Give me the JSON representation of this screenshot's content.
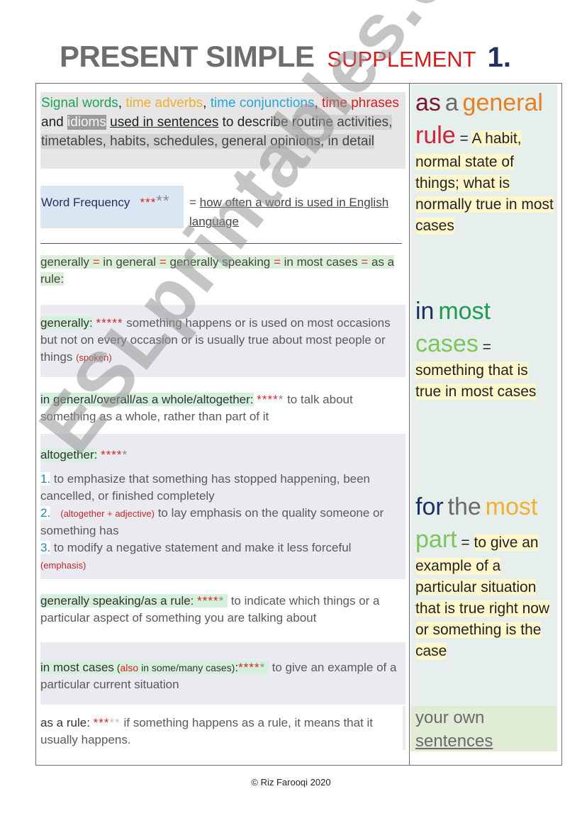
{
  "title": {
    "main": "PRESENT SIMPLE",
    "supplement": "SUPPLEMENT",
    "number": "1."
  },
  "intro": {
    "signal_words": "Signal words",
    "sep1": ", ",
    "time_adverbs": "time adverbs",
    "sep2": ", ",
    "time_conjunctions": "time conjunctions",
    "sep3": ", ",
    "time_phrases": "time phrases",
    "and": " and ",
    "idioms": "idioms",
    "space": " ",
    "used_in_sentences": "used in sentences",
    "to_describe": " to describe ",
    "routine": "routine activities",
    "rest": ", timetables, habits, schedules, general opinions,  in detail"
  },
  "frequency": {
    "label": "Word Frequency",
    "stars_red": "***",
    "stars_grey": "**",
    "eq": "=",
    "definition": "how often a word is used in English language"
  },
  "synonyms": {
    "items": [
      "generally",
      "in general",
      "generally speaking",
      "in most cases",
      "as a rule:"
    ],
    "eq": "="
  },
  "entries": [
    {
      "term": "generally:",
      "stars_red": "*****",
      "stars_grey": "",
      "definition": " something happens or is used on most occasions but not on every occasion or is usually true about most people or things ",
      "note": "(spoken)"
    },
    {
      "term": "in general/overall/as a whole/altogether:",
      "stars_red": "****",
      "stars_grey": "*",
      "definition": "  to talk about something as a whole, rather than part of it"
    },
    {
      "term": "altogether:",
      "stars_red": "****",
      "stars_grey": "*",
      "senses": [
        {
          "num": "1.",
          "text": " to emphasize that something has stopped happening, been cancelled, or finished completely"
        },
        {
          "num": "2.",
          "note": "(altogether + adjective)",
          "text": " to lay emphasis on the quality someone or something has"
        },
        {
          "num": "3.",
          "text": "  to modify a negative statement and make it less forceful",
          "note": "(emphasis)"
        }
      ]
    },
    {
      "term": "generally speaking/as a rule:",
      "stars_red": "****",
      "stars_grey": "*",
      "definition": "   to indicate which things or a particular aspect of something you are talking about"
    },
    {
      "term": "in most cases",
      "paren_open": " (",
      "also": "also",
      "also_rest": " in some/many cases)",
      "colon": ":",
      "stars_red": "****",
      "stars_grey": "*",
      "definition": "   to give an example of a particular current situation"
    },
    {
      "term": "as a rule:",
      "stars_red": "***",
      "stars_grey": "**",
      "definition": "  if something happens as a rule, it means that it usually  happens."
    }
  ],
  "sidebar": {
    "general_rule": {
      "w1": "as",
      "w2": "a",
      "w3": "general",
      "w4": "rule",
      "eq": " = ",
      "definition": "A habit, normal state of things; what is normally true in most cases"
    },
    "most_cases": {
      "w1": "in",
      "w2": "most",
      "w3": "cases",
      "eq": " = ",
      "definition": "something that is true in most cases"
    },
    "most_part": {
      "w1": "for",
      "w2": "the",
      "w3": "most",
      "w4": "part",
      "eq": " =  ",
      "definition": "to give an example of a particular situation that is true right now or  something is the case"
    },
    "own": {
      "line1": "your own",
      "line2": "sentences"
    }
  },
  "footer": "© Riz Farooqi 2020",
  "watermark": "ESLprintables.com"
}
